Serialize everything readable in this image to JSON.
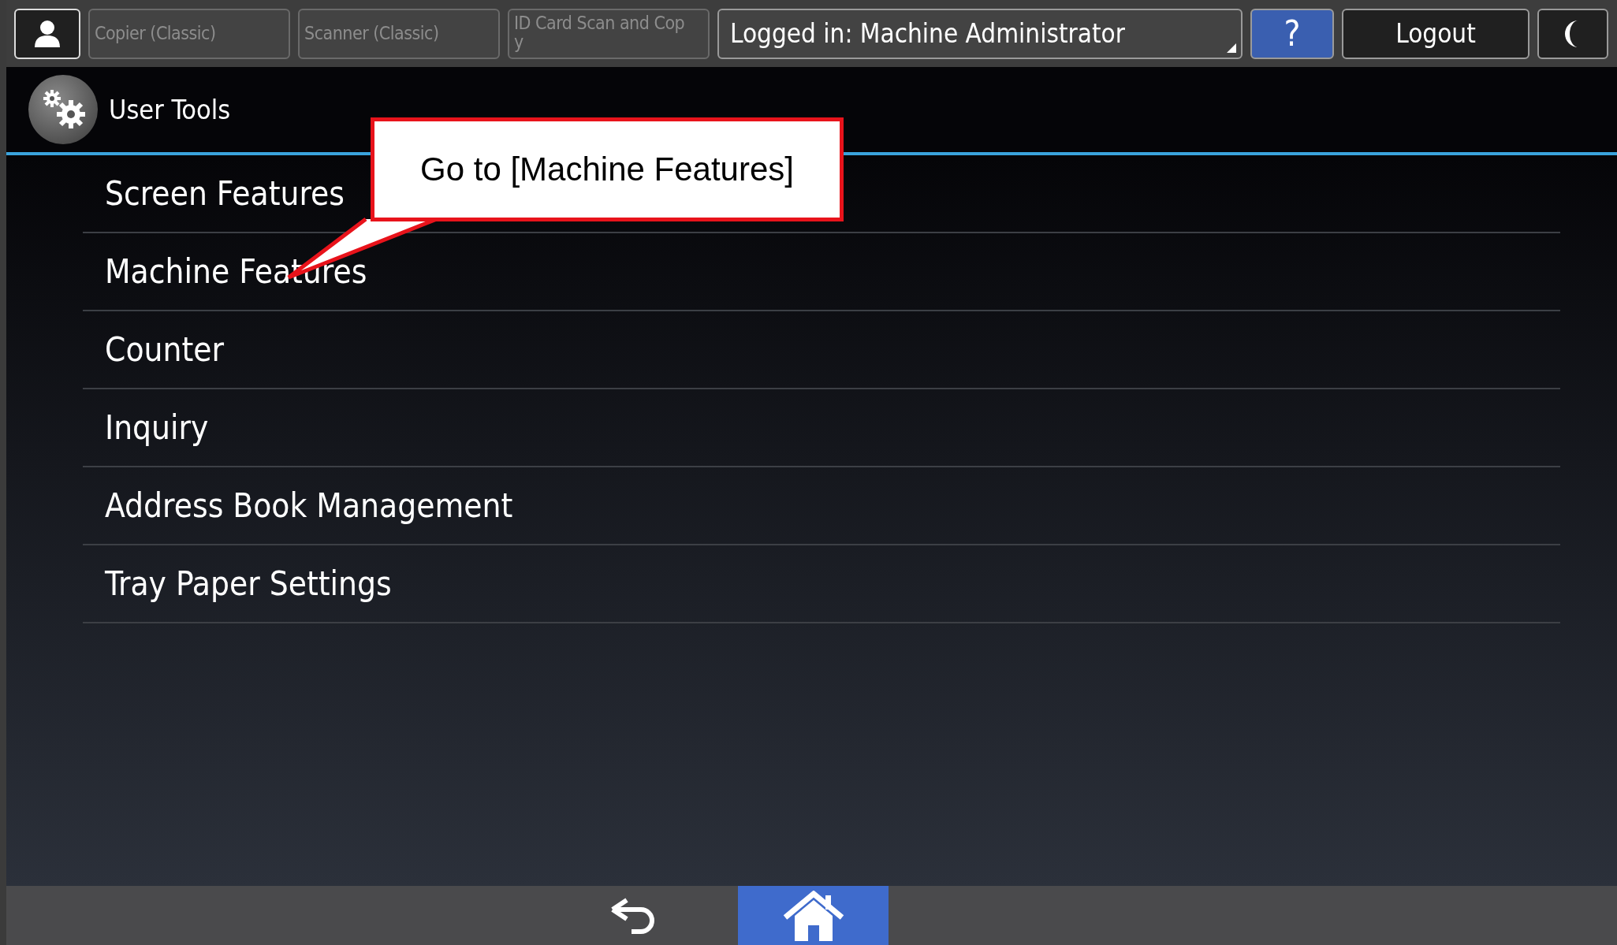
{
  "top_bar": {
    "apps": [
      {
        "label": "Copier (Classic)",
        "disabled": true
      },
      {
        "label": "Scanner (Classic)",
        "disabled": true
      },
      {
        "label": "ID Card Scan and Cop\ny",
        "disabled": true
      }
    ],
    "login": "Logged in: Machine Administrator",
    "help": "?",
    "logout": "Logout"
  },
  "header": {
    "title": "User Tools"
  },
  "menu": [
    {
      "label": "Screen Features"
    },
    {
      "label": "Machine Features"
    },
    {
      "label": "Counter"
    },
    {
      "label": "Inquiry"
    },
    {
      "label": "Address Book Management"
    },
    {
      "label": "Tray Paper Settings"
    }
  ],
  "callout": {
    "text": "Go to [Machine Features]"
  },
  "bottom_bar": {
    "home_selected": true
  }
}
